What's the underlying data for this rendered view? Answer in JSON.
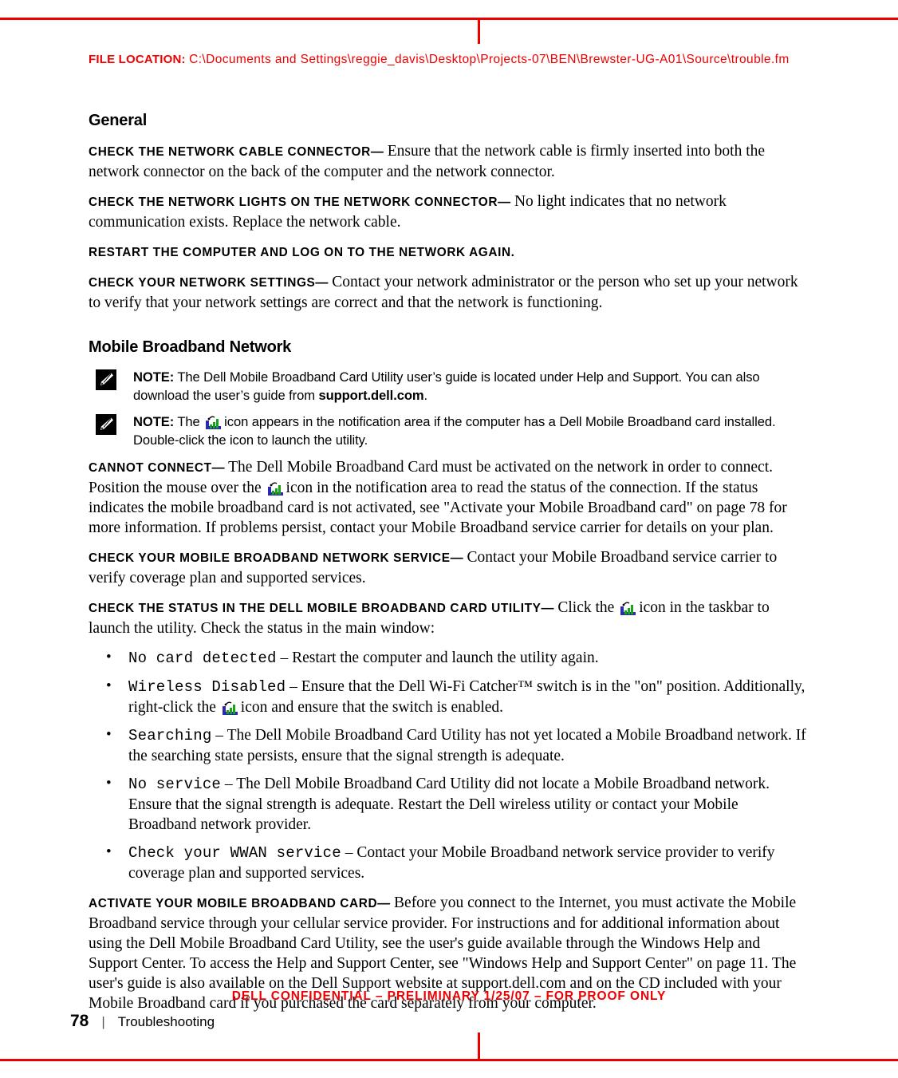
{
  "header": {
    "file_location_label": "FILE LOCATION:",
    "file_location_path": "C:\\Documents and Settings\\reggie_davis\\Desktop\\Projects-07\\BEN\\Brewster-UG-A01\\Source\\trouble.fm"
  },
  "sections": {
    "general": {
      "title": "General",
      "items": [
        {
          "head": "Check the network cable connector",
          "dash": "—",
          "body": "Ensure that the network cable is firmly inserted into both the network connector on the back of the computer and the network connector."
        },
        {
          "head": "Check the network lights on the network connector",
          "dash": "—",
          "body": "No light indicates that no network communication exists. Replace the network cable."
        },
        {
          "head": "Restart the computer and log on to the network again.",
          "dash": "",
          "body": ""
        },
        {
          "head": "Check your network settings",
          "dash": "—",
          "body": "Contact your network administrator or the person who set up your network to verify that your network settings are correct and that the network is functioning."
        }
      ]
    },
    "mobile_broadband": {
      "title": "Mobile Broadband Network",
      "notes": [
        {
          "label": "NOTE:",
          "text_before": "The Dell Mobile Broadband Card Utility user’s guide is located under Help and Support. You can also download the user’s guide from ",
          "emphasis": "support.dell.com",
          "text_after": "."
        },
        {
          "label": "NOTE:",
          "text_before": "The ",
          "text_after": "icon appears in the notification area if the computer has a Dell Mobile Broadband card installed. Double-click the icon to launch the utility."
        }
      ],
      "cannot_connect": {
        "head": "Cannot connect",
        "dash": "—",
        "body_part1": "The Dell Mobile Broadband Card must be activated on the network in order to connect. Position the mouse over the ",
        "body_part2": "icon in the notification area to read the status of the connection. If the status indicates the mobile broadband card is not activated, see \"Activate your Mobile Broadband card\" on page 78 for more information. If problems persist, contact your Mobile Broadband service carrier for details on your plan."
      },
      "check_service": {
        "head": "Check your Mobile Broadband network service",
        "dash": "—",
        "body": "Contact your Mobile Broadband service carrier to verify coverage plan and supported services."
      },
      "check_status": {
        "head": "Check the status in the Dell Mobile Broadband Card Utility",
        "dash": "—",
        "body_part1": "Click the ",
        "body_part2": "icon in the taskbar to launch the utility. Check the status in the main window:"
      },
      "status_list": [
        {
          "code": "No card detected",
          "dash": "–",
          "desc": "Restart the computer and launch the utility again."
        },
        {
          "code": "Wireless Disabled",
          "dash": "–",
          "desc_part1": "Ensure that the Dell Wi-Fi Catcher™ switch is in the \"on\" position. Additionally, right-click the ",
          "desc_part2": "icon and ensure that the switch is enabled."
        },
        {
          "code": "Searching",
          "dash": "–",
          "desc": "The Dell Mobile Broadband Card Utility has not yet located a Mobile Broadband network. If the searching state persists, ensure that the signal strength is adequate."
        },
        {
          "code": "No service",
          "dash": "–",
          "desc": "The Dell Mobile Broadband Card Utility did not locate a Mobile Broadband network. Ensure that the signal strength is adequate. Restart the Dell wireless utility or contact your Mobile Broadband network provider."
        },
        {
          "code": "Check your WWAN service",
          "dash": "–",
          "desc": "Contact your Mobile Broadband network service provider to verify coverage plan and supported services."
        }
      ],
      "activate": {
        "head": "Activate your Mobile Broadband card",
        "dash": "—",
        "body": "Before you connect to the Internet, you must activate the Mobile Broadband service through your cellular service provider. For instructions and for additional information about using the Dell Mobile Broadband Card Utility, see the user's guide available through the Windows Help and Support Center. To access the Help and Support Center, see \"Windows Help and Support Center\" on page 11. The user's guide is also available on the Dell Support website at support.dell.com and on the CD included with your Mobile Broadband card if you purchased the card separately from your computer."
      }
    }
  },
  "footer": {
    "confidential": "DELL CONFIDENTIAL – PRELIMINARY 1/25/07 – FOR PROOF ONLY",
    "page_number": "78",
    "separator": "|",
    "chapter": "Troubleshooting"
  },
  "colors": {
    "print_red": "#ee0000",
    "signal_green": "#00a000",
    "signal_blue": "#2a2ab0",
    "text_black": "#000000"
  }
}
